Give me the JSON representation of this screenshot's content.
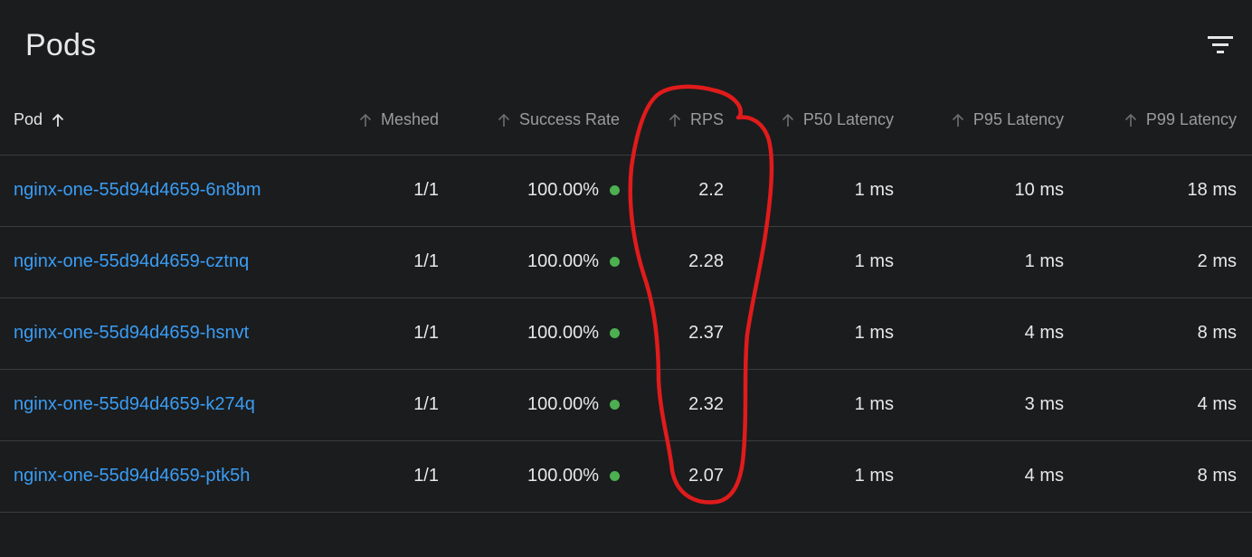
{
  "page": {
    "title": "Pods",
    "filter_icon": "filter-list-icon"
  },
  "table": {
    "headers": {
      "pod": "Pod",
      "meshed": "Meshed",
      "success_rate": "Success Rate",
      "rps": "RPS",
      "p50": "P50 Latency",
      "p95": "P95 Latency",
      "p99": "P99 Latency"
    },
    "sort_icon": "arrow-up-icon",
    "status_dot_color": "#4caf50",
    "link_color": "#3a9df4",
    "rows": [
      {
        "pod": "nginx-one-55d94d4659-6n8bm",
        "meshed": "1/1",
        "success_rate": "100.00%",
        "rps": "2.2",
        "p50": "1 ms",
        "p95": "10 ms",
        "p99": "18 ms"
      },
      {
        "pod": "nginx-one-55d94d4659-cztnq",
        "meshed": "1/1",
        "success_rate": "100.00%",
        "rps": "2.28",
        "p50": "1 ms",
        "p95": "1 ms",
        "p99": "2 ms"
      },
      {
        "pod": "nginx-one-55d94d4659-hsnvt",
        "meshed": "1/1",
        "success_rate": "100.00%",
        "rps": "2.37",
        "p50": "1 ms",
        "p95": "4 ms",
        "p99": "8 ms"
      },
      {
        "pod": "nginx-one-55d94d4659-k274q",
        "meshed": "1/1",
        "success_rate": "100.00%",
        "rps": "2.32",
        "p50": "1 ms",
        "p95": "3 ms",
        "p99": "4 ms"
      },
      {
        "pod": "nginx-one-55d94d4659-ptk5h",
        "meshed": "1/1",
        "success_rate": "100.00%",
        "rps": "2.07",
        "p50": "1 ms",
        "p95": "4 ms",
        "p99": "8 ms"
      }
    ]
  },
  "annotation": {
    "type": "hand-drawn-circle",
    "color": "#e01b1b",
    "target": "rps-column"
  }
}
